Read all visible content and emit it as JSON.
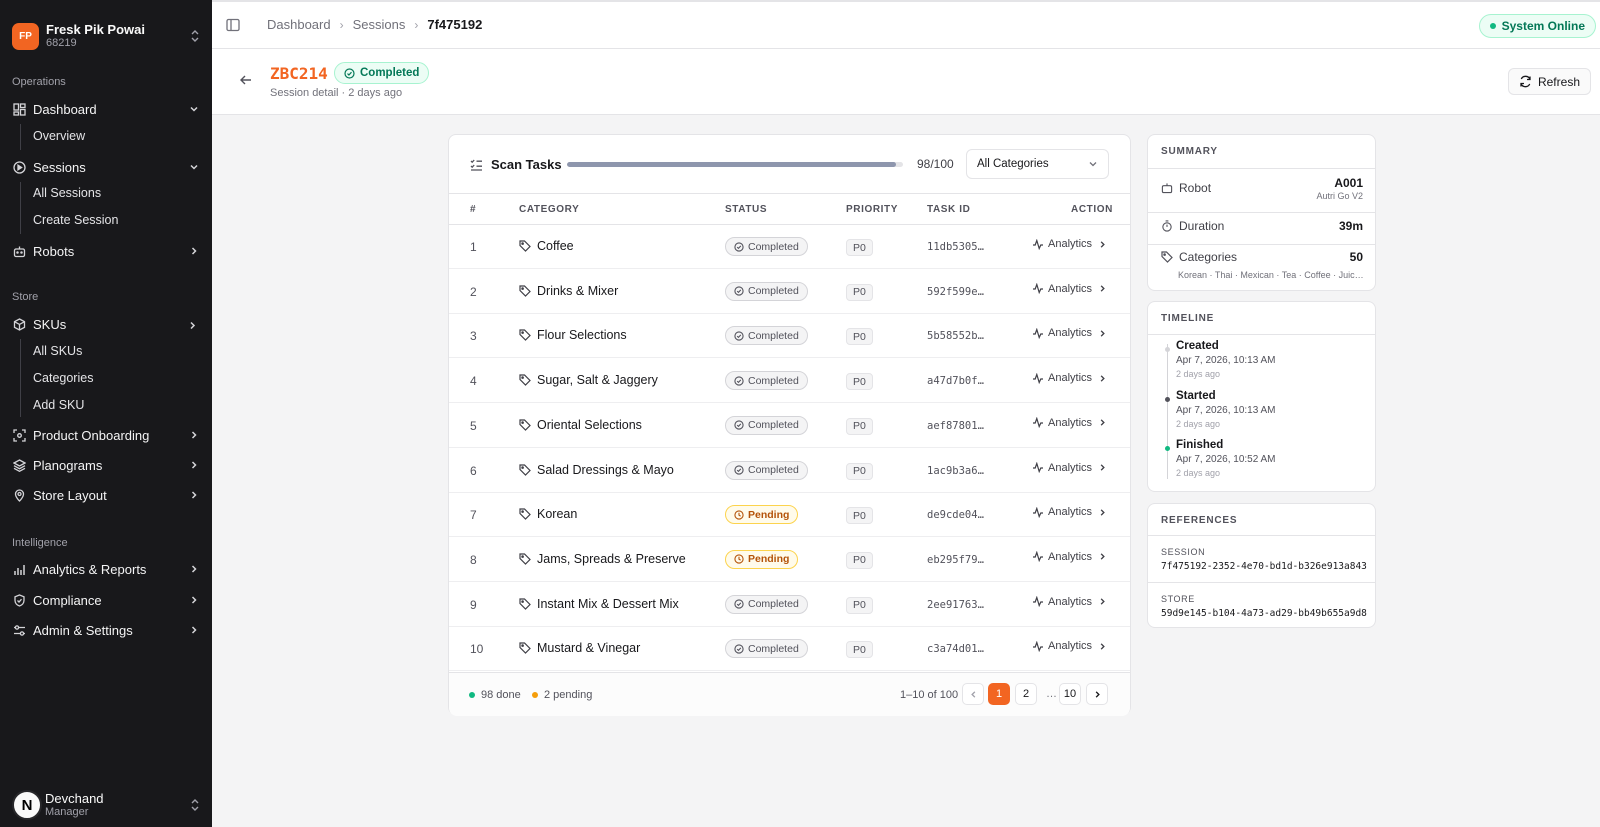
{
  "sidebar": {
    "org": {
      "initials": "FP",
      "name": "Fresk Pik Powai",
      "id": "68219"
    },
    "sections": {
      "operations": "Operations",
      "store": "Store",
      "intelligence": "Intelligence"
    },
    "nav": {
      "dashboard": "Dashboard",
      "overview": "Overview",
      "sessions": "Sessions",
      "all_sessions": "All Sessions",
      "create_session": "Create Session",
      "robots": "Robots",
      "skus": "SKUs",
      "all_skus": "All SKUs",
      "categories": "Categories",
      "add_sku": "Add SKU",
      "product_onboarding": "Product Onboarding",
      "planograms": "Planograms",
      "store_layout": "Store Layout",
      "analytics_reports": "Analytics & Reports",
      "compliance": "Compliance",
      "admin_settings": "Admin & Settings"
    },
    "user": {
      "initial": "N",
      "name": "Devchand",
      "role": "Manager"
    }
  },
  "topbar": {
    "breadcrumb": [
      "Dashboard",
      "Sessions",
      "7f475192"
    ],
    "system_status": "System Online"
  },
  "header": {
    "code": "ZBC214",
    "status": "Completed",
    "subtitle": "Session detail · 2 days ago",
    "refresh_label": "Refresh"
  },
  "tasks": {
    "title": "Scan Tasks",
    "progress": {
      "done": 98,
      "total": 100,
      "label": "98/100"
    },
    "filter": "All Categories",
    "columns": [
      "#",
      "CATEGORY",
      "STATUS",
      "PRIORITY",
      "TASK ID",
      "ACTION"
    ],
    "rows": [
      {
        "num": "1",
        "category": "Coffee",
        "status": "Completed",
        "priority": "P0",
        "task_id": "11db5305…",
        "action": "Analytics"
      },
      {
        "num": "2",
        "category": "Drinks & Mixer",
        "status": "Completed",
        "priority": "P0",
        "task_id": "592f599e…",
        "action": "Analytics"
      },
      {
        "num": "3",
        "category": "Flour Selections",
        "status": "Completed",
        "priority": "P0",
        "task_id": "5b58552b…",
        "action": "Analytics"
      },
      {
        "num": "4",
        "category": "Sugar, Salt & Jaggery",
        "status": "Completed",
        "priority": "P0",
        "task_id": "a47d7b0f…",
        "action": "Analytics"
      },
      {
        "num": "5",
        "category": "Oriental Selections",
        "status": "Completed",
        "priority": "P0",
        "task_id": "aef87801…",
        "action": "Analytics"
      },
      {
        "num": "6",
        "category": "Salad Dressings & Mayo",
        "status": "Completed",
        "priority": "P0",
        "task_id": "1ac9b3a6…",
        "action": "Analytics"
      },
      {
        "num": "7",
        "category": "Korean",
        "status": "Pending",
        "priority": "P0",
        "task_id": "de9cde04…",
        "action": "Analytics"
      },
      {
        "num": "8",
        "category": "Jams, Spreads & Preserve",
        "status": "Pending",
        "priority": "P0",
        "task_id": "eb295f79…",
        "action": "Analytics"
      },
      {
        "num": "9",
        "category": "Instant Mix & Dessert Mix",
        "status": "Completed",
        "priority": "P0",
        "task_id": "2ee91763…",
        "action": "Analytics"
      },
      {
        "num": "10",
        "category": "Mustard & Vinegar",
        "status": "Completed",
        "priority": "P0",
        "task_id": "c3a74d01…",
        "action": "Analytics"
      }
    ],
    "footer": {
      "done_label": "98 done",
      "pending_label": "2 pending",
      "range": "1–10 of 100",
      "pages": [
        "1",
        "2",
        "…",
        "10"
      ]
    }
  },
  "summary": {
    "title": "SUMMARY",
    "robot_label": "Robot",
    "robot_id": "A001",
    "robot_model": "Autri Go V2",
    "duration_label": "Duration",
    "duration": "39m",
    "categories_label": "Categories",
    "categories_count": "50",
    "categories_list": "Korean · Thai · Mexican · Tea · Coffee · Juic…"
  },
  "timeline": {
    "title": "TIMELINE",
    "events": [
      {
        "title": "Created",
        "date": "Apr 7, 2026, 10:13 AM",
        "ago": "2 days ago"
      },
      {
        "title": "Started",
        "date": "Apr 7, 2026, 10:13 AM",
        "ago": "2 days ago"
      },
      {
        "title": "Finished",
        "date": "Apr 7, 2026, 10:52 AM",
        "ago": "2 days ago"
      }
    ]
  },
  "references": {
    "title": "REFERENCES",
    "session_label": "SESSION",
    "session_id": "7f475192-2352-4e70-bd1d-b326e913a843",
    "store_label": "STORE",
    "store_id": "59d9e145-b104-4a73-ad29-bb49b655a9d8"
  },
  "colors": {
    "accent": "#f26522",
    "success": "#10b981",
    "warning": "#f59e0b",
    "sidebar": "#18181b"
  }
}
